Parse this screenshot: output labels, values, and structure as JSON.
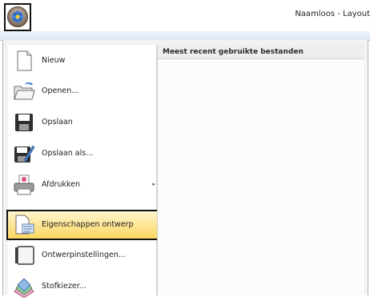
{
  "window": {
    "title": "Naamloos - Layout"
  },
  "app_button": {
    "icon": "app-flower-icon"
  },
  "menu": {
    "items": [
      {
        "label": "Nieuw",
        "icon": "new-document-icon"
      },
      {
        "label": "Openen...",
        "icon": "open-folder-icon"
      },
      {
        "label": "Opslaan",
        "icon": "save-disk-icon"
      },
      {
        "label": "Opslaan als...",
        "icon": "save-as-icon"
      },
      {
        "label": "Afdrukken",
        "icon": "printer-icon",
        "submenu_arrow": "▸"
      },
      {
        "label": "Eigenschappen ontwerp",
        "icon": "design-properties-icon",
        "highlighted": true
      },
      {
        "label": "Ontwerpinstellingen...",
        "icon": "design-settings-icon"
      },
      {
        "label": "Stofkiezer...",
        "icon": "fabric-selector-icon"
      }
    ]
  },
  "recent": {
    "header": "Meest recent gebruikte bestanden"
  },
  "colors": {
    "highlight": "#fde28b",
    "menu_bg": "#f3f3f3"
  }
}
